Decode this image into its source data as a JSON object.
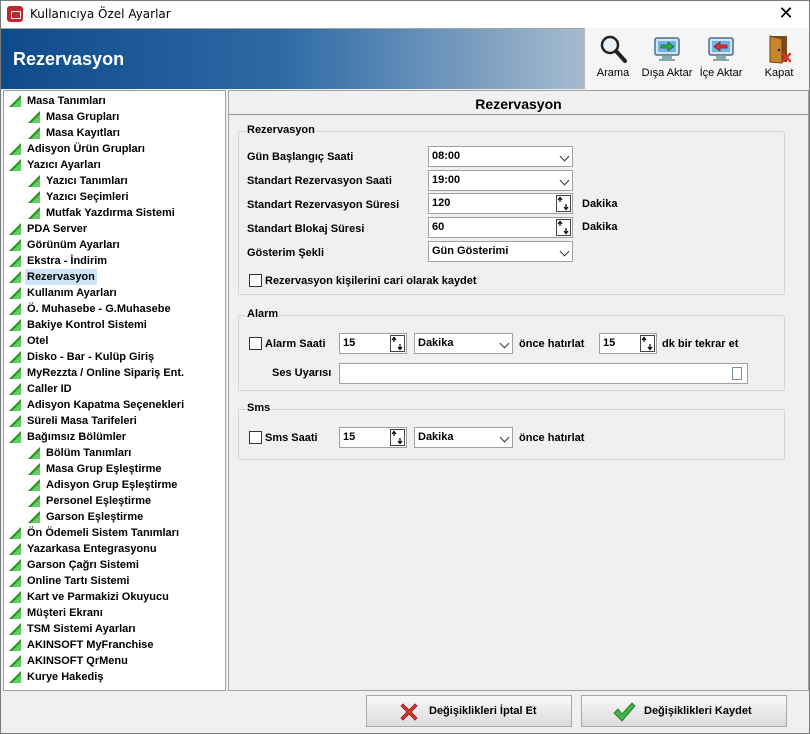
{
  "window": {
    "title": "Kullanıcıya Özel Ayarlar",
    "close_glyph": "✕"
  },
  "banner": {
    "title": "Rezervasyon"
  },
  "toolbar": [
    {
      "label": "Arama",
      "icon": "magnifier-icon"
    },
    {
      "label": "Dışa Aktar",
      "icon": "export-icon"
    },
    {
      "label": "İçe Aktar",
      "icon": "import-icon"
    },
    {
      "label": "Kapat",
      "icon": "door-exit-icon"
    }
  ],
  "tree": [
    {
      "label": "Masa Tanımları",
      "level": 0
    },
    {
      "label": "Masa Grupları",
      "level": 1
    },
    {
      "label": "Masa Kayıtları",
      "level": 1
    },
    {
      "label": "Adisyon Ürün Grupları",
      "level": 0
    },
    {
      "label": "Yazıcı Ayarları",
      "level": 0
    },
    {
      "label": "Yazıcı Tanımları",
      "level": 1
    },
    {
      "label": "Yazıcı Seçimleri",
      "level": 1
    },
    {
      "label": "Mutfak Yazdırma Sistemi",
      "level": 1
    },
    {
      "label": "PDA Server",
      "level": 0
    },
    {
      "label": "Görünüm Ayarları",
      "level": 0
    },
    {
      "label": "Ekstra - İndirim",
      "level": 0
    },
    {
      "label": "Rezervasyon",
      "level": 0,
      "selected": true
    },
    {
      "label": "Kullanım Ayarları",
      "level": 0
    },
    {
      "label": "Ö. Muhasebe - G.Muhasebe",
      "level": 0
    },
    {
      "label": "Bakiye Kontrol Sistemi",
      "level": 0
    },
    {
      "label": "Otel",
      "level": 0
    },
    {
      "label": "Disko - Bar - Kulüp Giriş",
      "level": 0
    },
    {
      "label": "MyRezzta / Online Sipariş Ent.",
      "level": 0
    },
    {
      "label": "Caller ID",
      "level": 0
    },
    {
      "label": "Adisyon Kapatma Seçenekleri",
      "level": 0
    },
    {
      "label": "Süreli Masa Tarifeleri",
      "level": 0
    },
    {
      "label": "Bağımsız Bölümler",
      "level": 0
    },
    {
      "label": "Bölüm Tanımları",
      "level": 1
    },
    {
      "label": "Masa Grup Eşleştirme",
      "level": 1
    },
    {
      "label": "Adisyon Grup Eşleştirme",
      "level": 1
    },
    {
      "label": "Personel Eşleştirme",
      "level": 1
    },
    {
      "label": "Garson Eşleştirme",
      "level": 1
    },
    {
      "label": "Ön Ödemeli Sistem Tanımları",
      "level": 0
    },
    {
      "label": "Yazarkasa Entegrasyonu",
      "level": 0
    },
    {
      "label": "Garson Çağrı Sistemi",
      "level": 0
    },
    {
      "label": "Online Tartı Sistemi",
      "level": 0
    },
    {
      "label": "Kart ve Parmakizi Okuyucu",
      "level": 0
    },
    {
      "label": "Müşteri Ekranı",
      "level": 0
    },
    {
      "label": "TSM Sistemi Ayarları",
      "level": 0
    },
    {
      "label": "AKINSOFT MyFranchise",
      "level": 0
    },
    {
      "label": "AKINSOFT QrMenu",
      "level": 0
    },
    {
      "label": "Kurye Hakediş",
      "level": 0
    }
  ],
  "panel": {
    "title": "Rezervasyon",
    "rezervasyon": {
      "group_title": "Rezervasyon",
      "start_label": "Gün Başlangıç Saati",
      "start_value": "08:00",
      "std_time_label": "Standart Rezervasyon Saati",
      "std_time_value": "19:00",
      "duration_label": "Standart Rezervasyon Süresi",
      "duration_value": "120",
      "duration_unit": "Dakika",
      "block_label": "Standart Blokaj Süresi",
      "block_value": "60",
      "block_unit": "Dakika",
      "display_label": "Gösterim Şekli",
      "display_value": "Gün Gösterimi",
      "save_as_current_label": "Rezervasyon kişilerini cari olarak kaydet",
      "save_as_current_checked": false
    },
    "alarm": {
      "group_title": "Alarm",
      "alarm_label": "Alarm Saati",
      "alarm_checked": false,
      "alarm_value": "15",
      "alarm_unit": "Dakika",
      "before_text": "önce hatırlat",
      "repeat_value": "15",
      "repeat_text": "dk bir tekrar et",
      "sound_label": "Ses Uyarısı",
      "sound_value": ""
    },
    "sms": {
      "group_title": "Sms",
      "sms_label": "Sms Saati",
      "sms_checked": false,
      "sms_value": "15",
      "sms_unit": "Dakika",
      "before_text": "önce hatırlat"
    }
  },
  "buttons": {
    "cancel_label": "Değişiklikleri İptal Et",
    "save_label": "Değişiklikleri Kaydet"
  },
  "colors": {
    "banner_start": "#0f4a8a",
    "selection": "#cce4f7",
    "tree_triangle": "#2f8a2f"
  }
}
